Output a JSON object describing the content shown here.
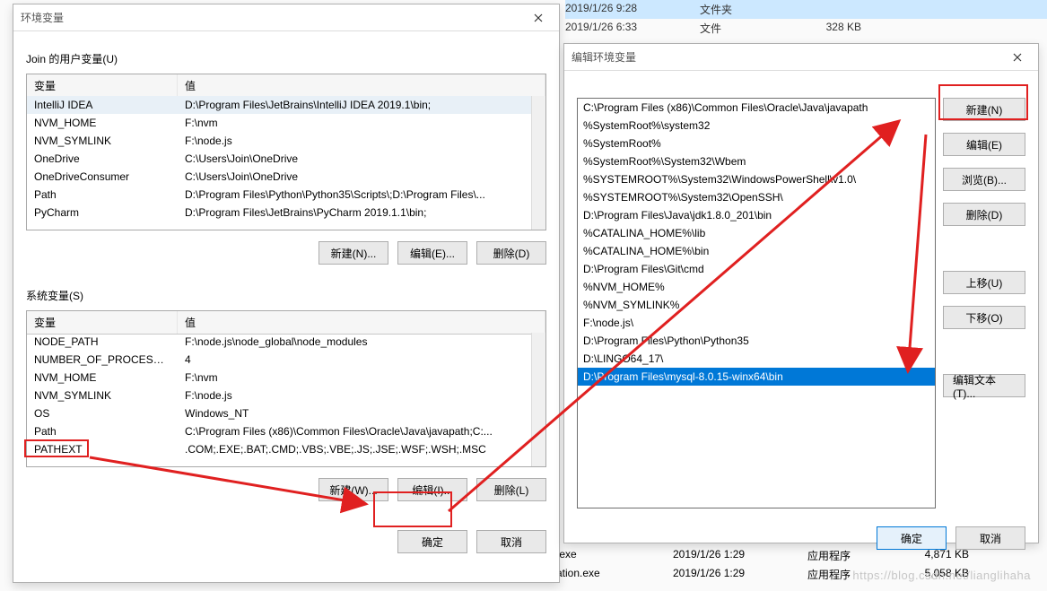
{
  "bg": {
    "rows": [
      {
        "date": "2019/1/26 9:28",
        "type": "文件夹",
        "size": ""
      },
      {
        "date": "2019/1/26 6:33",
        "type": "文件",
        "size": "328 KB"
      }
    ],
    "bottomRows": [
      {
        "name": ".exe",
        "date": "2019/1/26 1:29",
        "type": "应用程序",
        "size": "4,871 KB"
      },
      {
        "name": "ation.exe",
        "date": "2019/1/26 1:29",
        "type": "应用程序",
        "size": "5,058 KB"
      }
    ],
    "watermark": "https://blog.csdn.net/lianglihaha"
  },
  "envDialog": {
    "title": "环境变量",
    "userLabel": "Join 的用户变量(U)",
    "sysLabel": "系统变量(S)",
    "colVar": "变量",
    "colVal": "值",
    "userVars": [
      {
        "k": "IntelliJ IDEA",
        "v": "D:\\Program Files\\JetBrains\\IntelliJ IDEA 2019.1\\bin;"
      },
      {
        "k": "NVM_HOME",
        "v": "F:\\nvm"
      },
      {
        "k": "NVM_SYMLINK",
        "v": "F:\\node.js"
      },
      {
        "k": "OneDrive",
        "v": "C:\\Users\\Join\\OneDrive"
      },
      {
        "k": "OneDriveConsumer",
        "v": "C:\\Users\\Join\\OneDrive"
      },
      {
        "k": "Path",
        "v": "D:\\Program Files\\Python\\Python35\\Scripts\\;D:\\Program Files\\..."
      },
      {
        "k": "PyCharm",
        "v": "D:\\Program Files\\JetBrains\\PyCharm 2019.1.1\\bin;"
      }
    ],
    "sysVars": [
      {
        "k": "NODE_PATH",
        "v": "F:\\node.js\\node_global\\node_modules"
      },
      {
        "k": "NUMBER_OF_PROCESSORS",
        "v": "4"
      },
      {
        "k": "NVM_HOME",
        "v": "F:\\nvm"
      },
      {
        "k": "NVM_SYMLINK",
        "v": "F:\\node.js"
      },
      {
        "k": "OS",
        "v": "Windows_NT"
      },
      {
        "k": "Path",
        "v": "C:\\Program Files (x86)\\Common Files\\Oracle\\Java\\javapath;C:..."
      },
      {
        "k": "PATHEXT",
        "v": ".COM;.EXE;.BAT;.CMD;.VBS;.VBE;.JS;.JSE;.WSF;.WSH;.MSC"
      }
    ],
    "btnNewU": "新建(N)...",
    "btnEditU": "编辑(E)...",
    "btnDelU": "删除(D)",
    "btnNewW": "新建(W)...",
    "btnEditI": "编辑(I)...",
    "btnDelL": "删除(L)",
    "ok": "确定",
    "cancel": "取消"
  },
  "pathDialog": {
    "title": "编辑环境变量",
    "items": [
      "C:\\Program Files (x86)\\Common Files\\Oracle\\Java\\javapath",
      "%SystemRoot%\\system32",
      "%SystemRoot%",
      "%SystemRoot%\\System32\\Wbem",
      "%SYSTEMROOT%\\System32\\WindowsPowerShell\\v1.0\\",
      "%SYSTEMROOT%\\System32\\OpenSSH\\",
      "D:\\Program Files\\Java\\jdk1.8.0_201\\bin",
      "%CATALINA_HOME%\\lib",
      "%CATALINA_HOME%\\bin",
      "D:\\Program Files\\Git\\cmd",
      "%NVM_HOME%",
      "%NVM_SYMLINK%",
      "F:\\node.js\\",
      "D:\\Program Files\\Python\\Python35",
      "D:\\LINGO64_17\\",
      "D:\\Program Files\\mysql-8.0.15-winx64\\bin"
    ],
    "selectedIndex": 15,
    "btnNew": "新建(N)",
    "btnEdit": "编辑(E)",
    "btnBrowse": "浏览(B)...",
    "btnDelete": "删除(D)",
    "btnUp": "上移(U)",
    "btnDown": "下移(O)",
    "btnEditText": "编辑文本(T)...",
    "ok": "确定",
    "cancel": "取消"
  }
}
